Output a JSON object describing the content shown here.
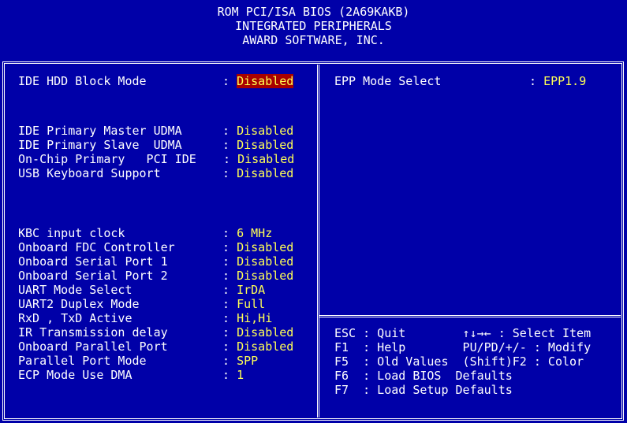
{
  "header": {
    "line1": "ROM PCI/ISA BIOS (2A69KAKB)",
    "line2": "INTEGRATED PERIPHERALS",
    "line3": "AWARD SOFTWARE, INC."
  },
  "settings": [
    {
      "label": "IDE HDD Block Mode",
      "sep": " : ",
      "value": "Disabled",
      "highlighted": true
    },
    {
      "label": "IDE Primary Master UDMA",
      "sep": " : ",
      "value": "Disabled"
    },
    {
      "label": "IDE Primary Slave  UDMA",
      "sep": " : ",
      "value": "Disabled"
    },
    {
      "label": "On-Chip Primary   PCI IDE",
      "sep": ": ",
      "value": "Disabled"
    },
    {
      "label": "USB Keyboard Support",
      "sep": " : ",
      "value": "Disabled"
    },
    {
      "label": "KBC input clock",
      "sep": " : ",
      "value": "6 MHz"
    },
    {
      "label": "Onboard FDC Controller",
      "sep": " : ",
      "value": "Disabled"
    },
    {
      "label": "Onboard Serial Port 1",
      "sep": " : ",
      "value": "Disabled"
    },
    {
      "label": "Onboard Serial Port 2",
      "sep": " : ",
      "value": "Disabled"
    },
    {
      "label": "UART Mode Select",
      "sep": " : ",
      "value": "IrDA"
    },
    {
      "label": "UART2 Duplex Mode",
      "sep": " : ",
      "value": "Full"
    },
    {
      "label": "RxD , TxD Active",
      "sep": " : ",
      "value": "Hi,Hi"
    },
    {
      "label": "IR Transmission delay",
      "sep": " : ",
      "value": "Disabled"
    },
    {
      "label": "Onboard Parallel Port",
      "sep": " : ",
      "value": "Disabled"
    },
    {
      "label": "Parallel Port Mode",
      "sep": " : ",
      "value": "SPP"
    },
    {
      "label": "ECP Mode Use DMA",
      "sep": " : ",
      "value": "1"
    }
  ],
  "right": {
    "epp_label": "EPP Mode Select",
    "epp_sep": ": ",
    "epp_value": "EPP1.9"
  },
  "help": [
    "ESC : Quit        ↑↓→← : Select Item",
    "F1  : Help        PU/PD/+/- : Modify",
    "F5  : Old Values  (Shift)F2 : Color",
    "F6  : Load BIOS  Defaults",
    "F7  : Load Setup Defaults"
  ],
  "colors": {
    "background": "#0000a8",
    "label": "#ffffff",
    "value": "#ffff55",
    "highlight": "#a80000"
  }
}
